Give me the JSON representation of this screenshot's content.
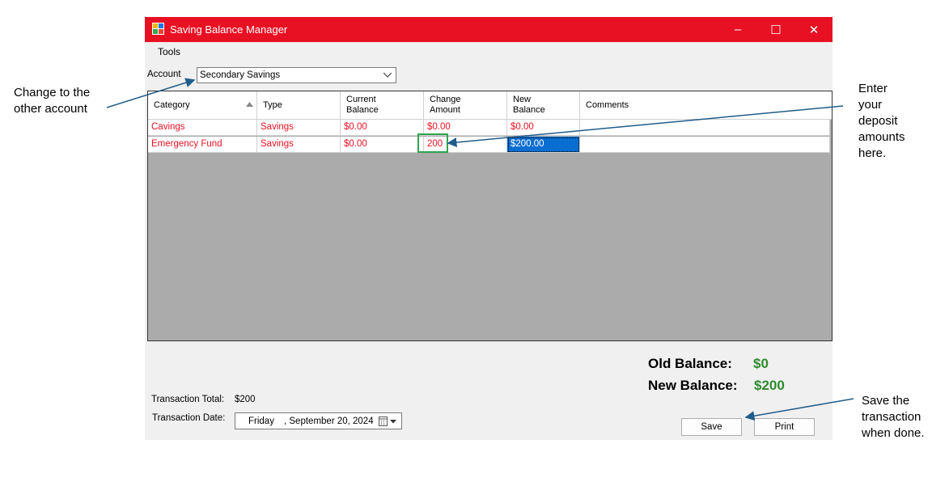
{
  "window": {
    "title": "Saving Balance Manager",
    "controls": [
      "–",
      "☐",
      "✕"
    ]
  },
  "menu": {
    "items": [
      "Tools"
    ]
  },
  "account": {
    "label": "Account",
    "selected": "Secondary Savings"
  },
  "grid": {
    "headers": [
      {
        "line1": "Category",
        "line2": ""
      },
      {
        "line1": "Type",
        "line2": ""
      },
      {
        "line1": "Current",
        "line2": "Balance"
      },
      {
        "line1": "Change",
        "line2": "Amount"
      },
      {
        "line1": "New",
        "line2": "Balance"
      },
      {
        "line1": "Comments",
        "line2": ""
      }
    ],
    "rows": [
      {
        "category": "Cavings",
        "type": "Savings",
        "current": "$0.00",
        "change": "$0.00",
        "new": "$0.00",
        "comments": ""
      },
      {
        "category": "Emergency Fund",
        "type": "Savings",
        "current": "$0.00",
        "change": "200",
        "new": "$200.00",
        "comments": ""
      }
    ]
  },
  "balances": {
    "old_label": "Old Balance:",
    "old_value": "$0",
    "new_label": "New Balance:",
    "new_value": "$200"
  },
  "transaction": {
    "total_label": "Transaction Total:",
    "total_value": "$200",
    "date_label": "Transaction Date:",
    "date_day": "Friday",
    "date_rest": ", September 20, 2024"
  },
  "buttons": {
    "save": "Save",
    "print": "Print"
  },
  "annotations": {
    "account_note": [
      "Change to the",
      "other account"
    ],
    "deposit_note": [
      "Enter",
      "your",
      "deposit",
      "amounts",
      "here."
    ],
    "save_note": [
      "Save the",
      "transaction",
      "when done."
    ]
  },
  "colors": {
    "titlebar": "#e81123",
    "row_text": "#e81123",
    "balance_value": "#2e8b2e",
    "highlight_box": "#2ea44f",
    "arrow": "#1f5c8a"
  }
}
